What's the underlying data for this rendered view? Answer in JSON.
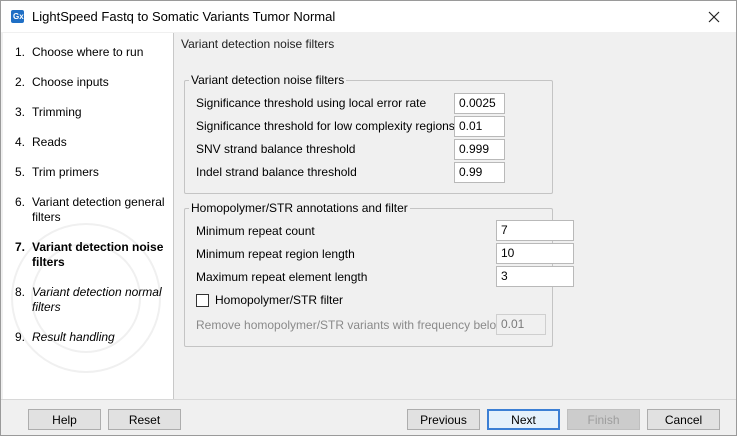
{
  "window": {
    "title": "LightSpeed Fastq to Somatic Variants Tumor Normal",
    "app_icon_text": "Gx"
  },
  "sidebar": {
    "steps": [
      {
        "num": "1.",
        "label": "Choose where to run"
      },
      {
        "num": "2.",
        "label": "Choose inputs"
      },
      {
        "num": "3.",
        "label": "Trimming"
      },
      {
        "num": "4.",
        "label": "Reads"
      },
      {
        "num": "5.",
        "label": "Trim primers"
      },
      {
        "num": "6.",
        "label": "Variant detection general filters"
      },
      {
        "num": "7.",
        "label": "Variant detection noise filters"
      },
      {
        "num": "8.",
        "label": "Variant detection normal filters"
      },
      {
        "num": "9.",
        "label": "Result handling"
      }
    ]
  },
  "main": {
    "page_title": "Variant detection noise filters",
    "noise_group": {
      "title": "Variant detection noise filters",
      "rows": [
        {
          "label": "Significance threshold using local error rate",
          "value": "0.0025"
        },
        {
          "label": "Significance threshold for low complexity regions",
          "value": "0.01"
        },
        {
          "label": "SNV strand balance threshold",
          "value": "0.999"
        },
        {
          "label": "Indel strand balance threshold",
          "value": "0.99"
        }
      ]
    },
    "homopolymer_group": {
      "title": "Homopolymer/STR annotations and filter",
      "rows": [
        {
          "label": "Minimum repeat count",
          "value": "7"
        },
        {
          "label": "Minimum repeat region length",
          "value": "10"
        },
        {
          "label": "Maximum repeat element length",
          "value": "3"
        }
      ],
      "checkbox_label": "Homopolymer/STR filter",
      "checkbox_checked": false,
      "remove_label": "Remove homopolymer/STR variants with frequency below",
      "remove_value": "0.01"
    }
  },
  "footer": {
    "help": "Help",
    "reset": "Reset",
    "previous": "Previous",
    "next": "Next",
    "finish": "Finish",
    "cancel": "Cancel"
  },
  "colors": {
    "accent": "#3c7fd4",
    "app_icon": "#1f6fc5"
  }
}
